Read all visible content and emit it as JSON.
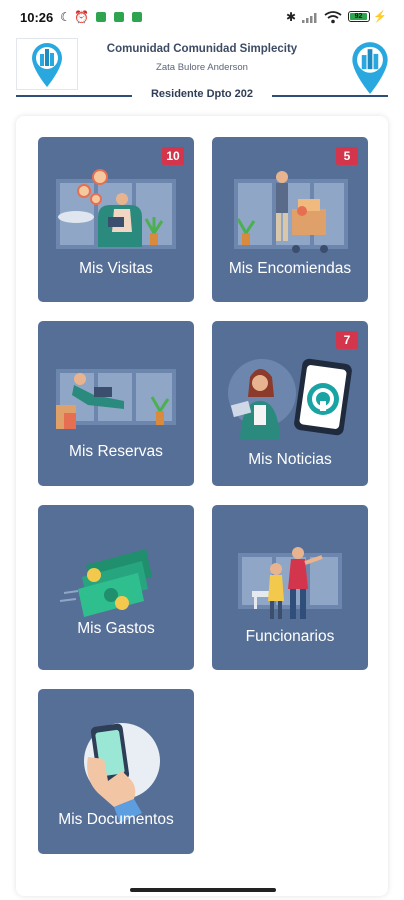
{
  "status_bar": {
    "time": "10:26",
    "battery": "92"
  },
  "header": {
    "community": "Comunidad Comunidad Simplecity",
    "user_name": "Zata Bulore Anderson",
    "residence": "Residente Dpto 202"
  },
  "tiles": [
    {
      "label": "Mis Visitas",
      "badge": "10"
    },
    {
      "label": "Mis Encomiendas",
      "badge": "5"
    },
    {
      "label": "Mis Reservas",
      "badge": ""
    },
    {
      "label": "Mis Noticias",
      "badge": "7"
    },
    {
      "label": "Mis Gastos",
      "badge": ""
    },
    {
      "label": "Funcionarios",
      "badge": ""
    },
    {
      "label": "Mis Documentos",
      "badge": ""
    }
  ],
  "colors": {
    "tile": "#566f97",
    "badge": "#d3364c",
    "accent_line": "#2f4e7a",
    "pin": "#29a8e0"
  }
}
